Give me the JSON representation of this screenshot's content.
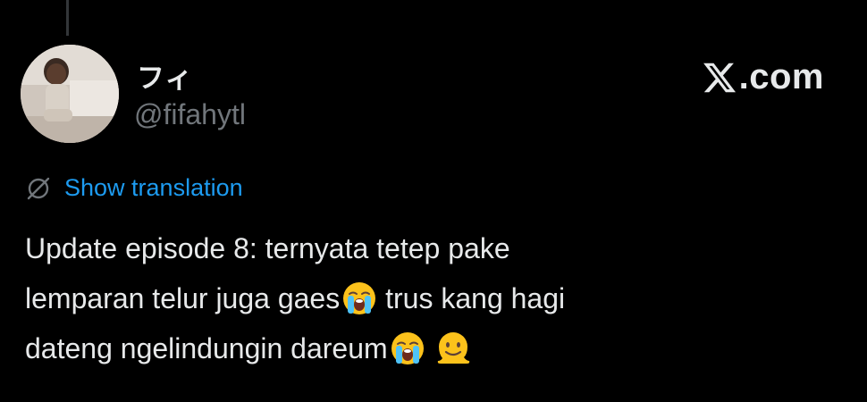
{
  "user": {
    "display_name": "フィ",
    "handle": "@fifahytl"
  },
  "brand": {
    "text": ".com",
    "logo_icon": "x-logo-icon"
  },
  "translation": {
    "icon": "globe-slash-icon",
    "label": "Show translation"
  },
  "tweet": {
    "line1": "Update episode 8: ternyata tetep pake",
    "line2_a": "lemparan telur juga gaes",
    "line2_emoji": "loudly-crying-face",
    "line2_b": " trus kang hagi",
    "line3_a": "dateng ngelindungin dareum",
    "line3_emoji1": "loudly-crying-face",
    "line3_emoji2": "melting-face"
  },
  "colors": {
    "background": "#000000",
    "text": "#e7e9ea",
    "secondary": "#71767b",
    "link": "#1d9bf0"
  }
}
